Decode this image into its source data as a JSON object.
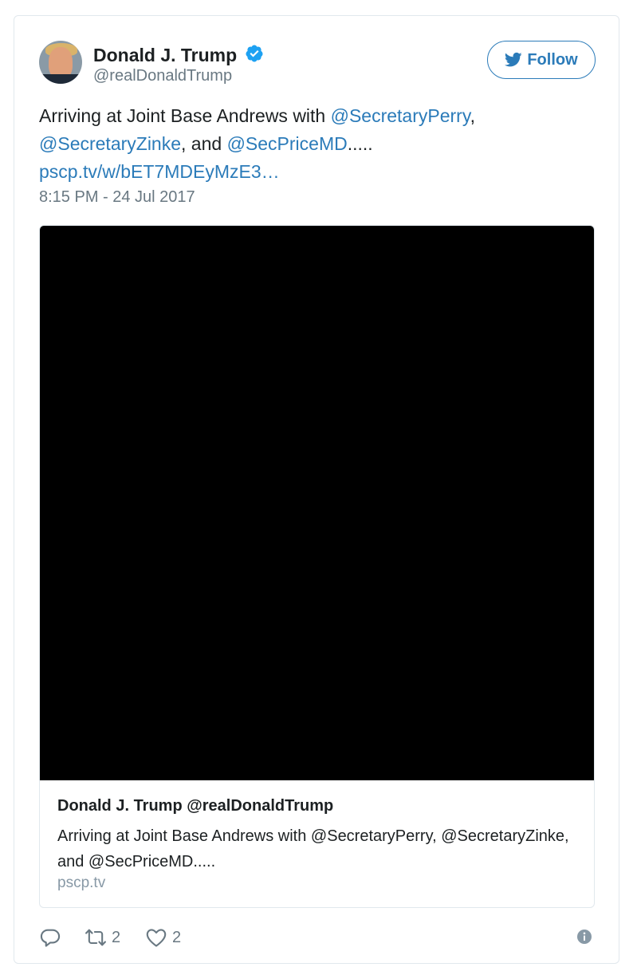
{
  "author": {
    "name": "Donald J. Trump",
    "handle": "@realDonaldTrump",
    "verified": true
  },
  "follow_button": {
    "label": "Follow"
  },
  "tweet": {
    "text_prefix": "Arriving at Joint Base Andrews with ",
    "mention_1": "@SecretaryPerry",
    "text_comma": ",",
    "mention_2": "@SecretaryZinke",
    "text_and": ", and ",
    "mention_3": "@SecPriceMD",
    "text_suffix": ".....",
    "link": "pscp.tv/w/bET7MDEyMzE3…",
    "timestamp": "8:15 PM - 24 Jul 2017"
  },
  "card": {
    "title": "Donald J. Trump @realDonaldTrump",
    "description": "Arriving at Joint Base Andrews with @SecretaryPerry, @SecretaryZinke, and @SecPriceMD.....",
    "domain": "pscp.tv"
  },
  "actions": {
    "retweet_count": "2",
    "like_count": "2"
  },
  "colors": {
    "link": "#2b7bb9",
    "verified": "#1da1f2",
    "muted": "#697882"
  }
}
